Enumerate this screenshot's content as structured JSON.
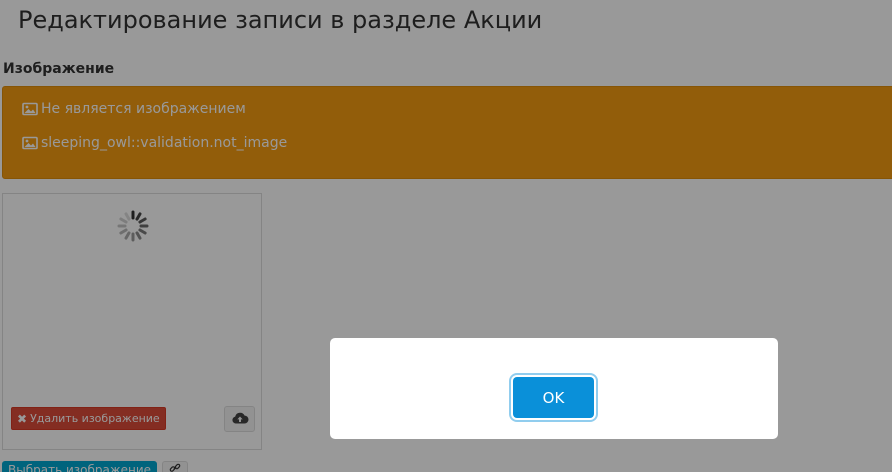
{
  "page": {
    "title": "Редактирование записи в разделе Акции"
  },
  "field": {
    "label": "Изображение"
  },
  "alert": {
    "messages": [
      {
        "icon": "image-icon",
        "text": "Не является изображением"
      },
      {
        "icon": "image-icon",
        "text": "sleeping_owl::validation.not_image"
      }
    ],
    "color": "#f39c12"
  },
  "image_upload": {
    "loading_icon": "spinner-icon",
    "delete_label": "Удалить изображение",
    "upload_icon": "cloud-upload-icon",
    "choose_label": "Выбрать изображение",
    "link_icon": "link-icon"
  },
  "dialog": {
    "ok_label": "OK",
    "ok_color": "#0a90d9"
  }
}
